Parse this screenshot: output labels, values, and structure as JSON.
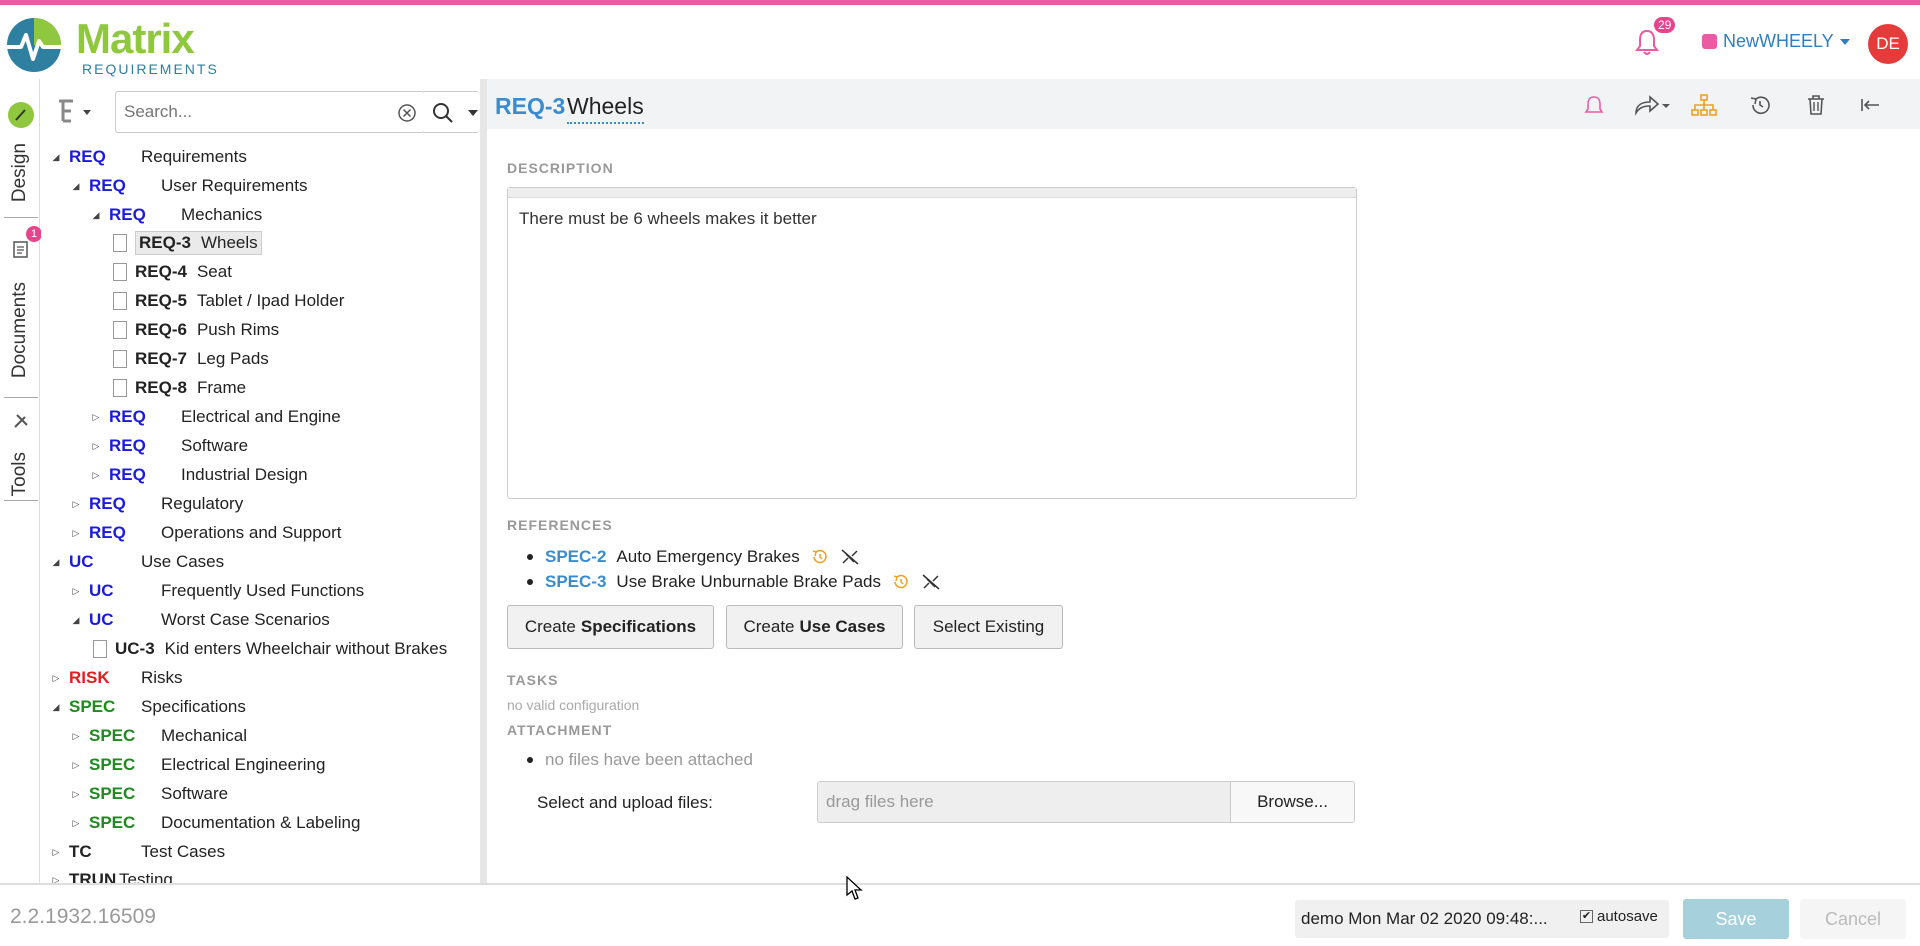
{
  "app": {
    "logo_text": "Matrix",
    "logo_sub": "REQUIREMENTS"
  },
  "header": {
    "notification_count": "29",
    "project_name": "NewWHEELY",
    "avatar_initials": "DE",
    "accent_color": "#ec5aa4"
  },
  "vtabs": {
    "design": "Design",
    "documents": "Documents",
    "documents_badge": "1",
    "tools": "Tools",
    "help": "?"
  },
  "search": {
    "placeholder": "Search..."
  },
  "tree": {
    "rows": [
      {
        "cat": "REQ",
        "label": "Requirements"
      },
      {
        "cat": "REQ",
        "label": "User Requirements"
      },
      {
        "cat": "REQ",
        "label": "Mechanics"
      },
      {
        "id": "REQ-3",
        "label": "Wheels"
      },
      {
        "id": "REQ-4",
        "label": "Seat"
      },
      {
        "id": "REQ-5",
        "label": "Tablet / Ipad Holder"
      },
      {
        "id": "REQ-6",
        "label": "Push Rims"
      },
      {
        "id": "REQ-7",
        "label": "Leg Pads"
      },
      {
        "id": "REQ-8",
        "label": "Frame"
      },
      {
        "cat": "REQ",
        "label": "Electrical and Engine"
      },
      {
        "cat": "REQ",
        "label": "Software"
      },
      {
        "cat": "REQ",
        "label": "Industrial Design"
      },
      {
        "cat": "REQ",
        "label": "Regulatory"
      },
      {
        "cat": "REQ",
        "label": "Operations and Support"
      },
      {
        "cat": "UC",
        "label": "Use Cases"
      },
      {
        "cat": "UC",
        "label": "Frequently Used Functions"
      },
      {
        "cat": "UC",
        "label": "Worst Case Scenarios"
      },
      {
        "id": "UC-3",
        "label": "Kid enters Wheelchair without Brakes"
      },
      {
        "cat": "RISK",
        "label": "Risks"
      },
      {
        "cat": "SPEC",
        "label": "Specifications"
      },
      {
        "cat": "SPEC",
        "label": "Mechanical"
      },
      {
        "cat": "SPEC",
        "label": "Electrical Engineering"
      },
      {
        "cat": "SPEC",
        "label": "Software"
      },
      {
        "cat": "SPEC",
        "label": "Documentation & Labeling"
      },
      {
        "cat": "TC",
        "label": "Test Cases"
      },
      {
        "cat": "TRUN",
        "label": "Testing"
      }
    ]
  },
  "item": {
    "id": "REQ-3",
    "title": "Wheels",
    "description_label": "DESCRIPTION",
    "description": "There must be 6 wheels makes it better",
    "references_label": "REFERENCES",
    "references": [
      {
        "id": "SPEC-2",
        "label": "Auto Emergency Brakes"
      },
      {
        "id": "SPEC-3",
        "label": "Use Brake Unburnable Brake Pads"
      }
    ],
    "btn_create_spec_prefix": "Create",
    "btn_create_spec_bold": "Specifications",
    "btn_create_uc_prefix": "Create",
    "btn_create_uc_bold": "Use Cases",
    "btn_select_existing": "Select Existing",
    "tasks_label": "TASKS",
    "tasks_note": "no valid configuration",
    "attachment_label": "ATTACHMENT",
    "attachment_empty": "no files have been attached",
    "upload_label": "Select and upload files:",
    "dropzone": "drag files here",
    "browse": "Browse..."
  },
  "footer": {
    "version": "2.2.1932.16509",
    "status": "demo Mon Mar 02 2020 09:48:...",
    "autosave": "autosave",
    "autosave_checked": true,
    "save": "Save",
    "cancel": "Cancel"
  }
}
